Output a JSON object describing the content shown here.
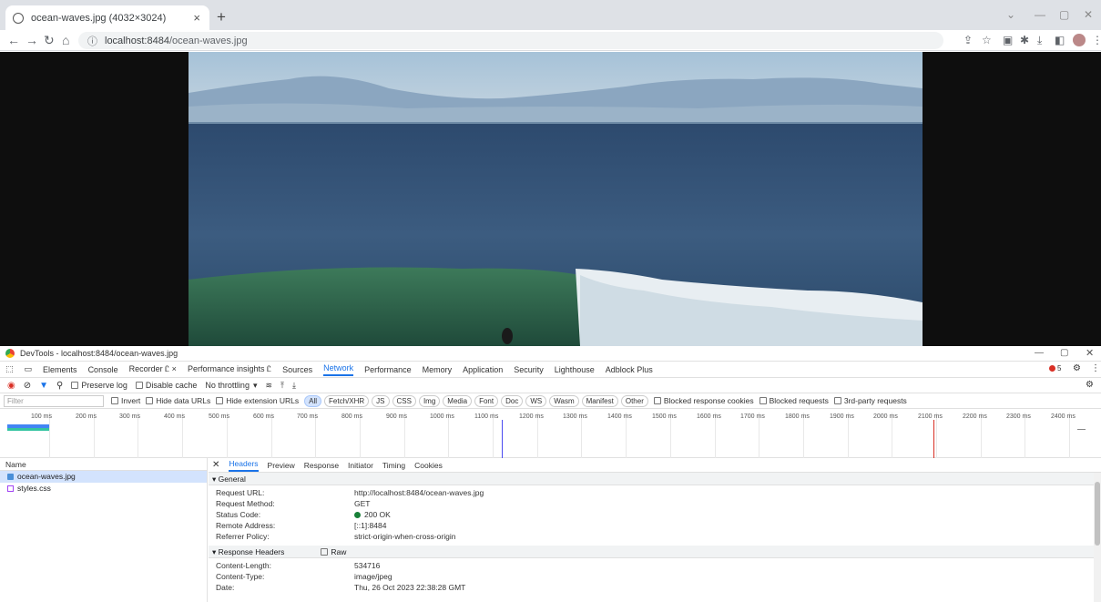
{
  "browser": {
    "tab_title": "ocean-waves.jpg (4032×3024)",
    "tab_close": "×",
    "new_tab": "+",
    "url_host": "localhost:8484",
    "url_path": "/ocean-waves.jpg"
  },
  "devtools": {
    "window_title": "DevTools - localhost:8484/ocean-waves.jpg",
    "tabs": [
      "Elements",
      "Console",
      "Recorder Ꮭ ×",
      "Performance insights Ꮭ",
      "Sources",
      "Network",
      "Performance",
      "Memory",
      "Application",
      "Security",
      "Lighthouse",
      "Adblock Plus"
    ],
    "active_tab": "Network",
    "error_count": "5",
    "toolbar": {
      "preserve_log": "Preserve log",
      "disable_cache": "Disable cache",
      "throttling": "No throttling"
    },
    "filter": {
      "placeholder": "Filter",
      "invert": "Invert",
      "hide_data_urls": "Hide data URLs",
      "hide_ext_urls": "Hide extension URLs",
      "chips": [
        "All",
        "Fetch/XHR",
        "JS",
        "CSS",
        "Img",
        "Media",
        "Font",
        "Doc",
        "WS",
        "Wasm",
        "Manifest",
        "Other"
      ],
      "blocked_cookies": "Blocked response cookies",
      "blocked_requests": "Blocked requests",
      "third_party": "3rd-party requests"
    },
    "timeline_labels": [
      "100 ms",
      "200 ms",
      "300 ms",
      "400 ms",
      "500 ms",
      "600 ms",
      "700 ms",
      "800 ms",
      "900 ms",
      "1000 ms",
      "1100 ms",
      "1200 ms",
      "1300 ms",
      "1400 ms",
      "1500 ms",
      "1600 ms",
      "1700 ms",
      "1800 ms",
      "1900 ms",
      "2000 ms",
      "2100 ms",
      "2200 ms",
      "2300 ms",
      "2400 ms"
    ],
    "name_header": "Name",
    "requests": [
      "ocean-waves.jpg",
      "styles.css"
    ],
    "detail_tabs": [
      "Headers",
      "Preview",
      "Response",
      "Initiator",
      "Timing",
      "Cookies"
    ],
    "general_header": "▾ General",
    "general": [
      {
        "k": "Request URL:",
        "v": "http://localhost:8484/ocean-waves.jpg"
      },
      {
        "k": "Request Method:",
        "v": "GET"
      },
      {
        "k": "Status Code:",
        "v": "200 OK"
      },
      {
        "k": "Remote Address:",
        "v": "[::1]:8484"
      },
      {
        "k": "Referrer Policy:",
        "v": "strict-origin-when-cross-origin"
      }
    ],
    "response_header": "▾ Response Headers",
    "raw_label": "Raw",
    "response": [
      {
        "k": "Content-Length:",
        "v": "534716"
      },
      {
        "k": "Content-Type:",
        "v": "image/jpeg"
      },
      {
        "k": "Date:",
        "v": "Thu, 26 Oct 2023 22:38:28 GMT"
      }
    ]
  }
}
